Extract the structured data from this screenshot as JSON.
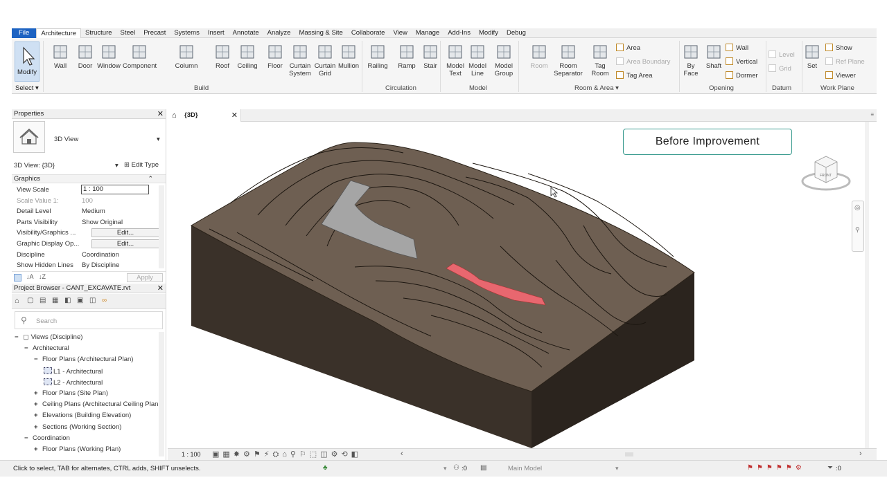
{
  "menu": [
    "File",
    "Architecture",
    "Structure",
    "Steel",
    "Precast",
    "Systems",
    "Insert",
    "Annotate",
    "Analyze",
    "Massing & Site",
    "Collaborate",
    "View",
    "Manage",
    "Add-Ins",
    "Modify",
    "Debug"
  ],
  "ribbon": {
    "select": "Select",
    "modify": "Modify",
    "build_tools": [
      {
        "l1": "Wall",
        "l2": ""
      },
      {
        "l1": "Door",
        "l2": ""
      },
      {
        "l1": "Window",
        "l2": ""
      },
      {
        "l1": "Component",
        "l2": ""
      },
      {
        "l1": "Column",
        "l2": ""
      },
      {
        "l1": "Roof",
        "l2": ""
      },
      {
        "l1": "Ceiling",
        "l2": ""
      },
      {
        "l1": "Floor",
        "l2": ""
      },
      {
        "l1": "Curtain",
        "l2": "System"
      },
      {
        "l1": "Curtain",
        "l2": "Grid"
      },
      {
        "l1": "Mullion",
        "l2": ""
      }
    ],
    "circulation_tools": [
      {
        "l1": "Railing",
        "l2": ""
      },
      {
        "l1": "Ramp",
        "l2": ""
      },
      {
        "l1": "Stair",
        "l2": ""
      }
    ],
    "model_tools": [
      {
        "l1": "Model",
        "l2": "Text"
      },
      {
        "l1": "Model",
        "l2": "Line"
      },
      {
        "l1": "Model",
        "l2": "Group"
      }
    ],
    "room_tools": [
      {
        "l1": "Room",
        "l2": ""
      },
      {
        "l1": "Room",
        "l2": "Separator"
      },
      {
        "l1": "Tag",
        "l2": "Room"
      }
    ],
    "area_items": [
      "Area",
      "Area Boundary",
      "Tag Area"
    ],
    "opening_tools": [
      {
        "l1": "By",
        "l2": "Face"
      },
      {
        "l1": "Shaft",
        "l2": ""
      }
    ],
    "opening_items": [
      "Wall",
      "Vertical",
      "Dormer"
    ],
    "datum_items": [
      "Level",
      "Grid"
    ],
    "workplane_tools": [
      "Set"
    ],
    "workplane_items": [
      "Show",
      "Ref Plane",
      "Viewer"
    ],
    "panels": [
      "Build",
      "Circulation",
      "Model",
      "Room & Area",
      "Opening",
      "Datum",
      "Work Plane"
    ]
  },
  "properties": {
    "title": "Properties",
    "type_name": "3D View",
    "selector": "3D View: {3D}",
    "edit_type": "Edit Type",
    "section": "Graphics",
    "rows": [
      {
        "label": "View Scale",
        "value": "1 : 100"
      },
      {
        "label": "Scale Value    1:",
        "value": "100"
      },
      {
        "label": "Detail Level",
        "value": "Medium"
      },
      {
        "label": "Parts Visibility",
        "value": "Show Original"
      },
      {
        "label": "Visibility/Graphics ...",
        "value": "Edit..."
      },
      {
        "label": "Graphic Display Op...",
        "value": "Edit..."
      },
      {
        "label": "Discipline",
        "value": "Coordination"
      },
      {
        "label": "Show Hidden Lines",
        "value": "By Discipline"
      }
    ],
    "apply": "Apply"
  },
  "browser": {
    "title": "Project Browser - CANT_EXCAVATE.rvt",
    "search_placeholder": "Search",
    "tree": [
      {
        "indent": 0,
        "sign": "−",
        "text": "Views (Discipline)"
      },
      {
        "indent": 1,
        "sign": "−",
        "text": "Architectural"
      },
      {
        "indent": 2,
        "sign": "−",
        "text": "Floor Plans (Architectural Plan)"
      },
      {
        "indent": 3,
        "sign": "",
        "text": "L1 - Architectural"
      },
      {
        "indent": 3,
        "sign": "",
        "text": "L2 - Architectural"
      },
      {
        "indent": 2,
        "sign": "+",
        "text": "Floor Plans (Site Plan)"
      },
      {
        "indent": 2,
        "sign": "+",
        "text": "Ceiling Plans (Architectural Ceiling Plan"
      },
      {
        "indent": 2,
        "sign": "+",
        "text": "Elevations (Building Elevation)"
      },
      {
        "indent": 2,
        "sign": "+",
        "text": "Sections (Working Section)"
      },
      {
        "indent": 1,
        "sign": "−",
        "text": "Coordination"
      },
      {
        "indent": 2,
        "sign": "+",
        "text": "Floor Plans (Working Plan)"
      }
    ]
  },
  "viewport": {
    "tab": "{3D}",
    "badge": "Before Improvement",
    "scale": "1 : 100"
  },
  "status": {
    "hint": "Click to select, TAB for alternates, CTRL adds, SHIFT unselects.",
    "model": "Main Model",
    "count_left": ":0",
    "count_right": ":0"
  }
}
